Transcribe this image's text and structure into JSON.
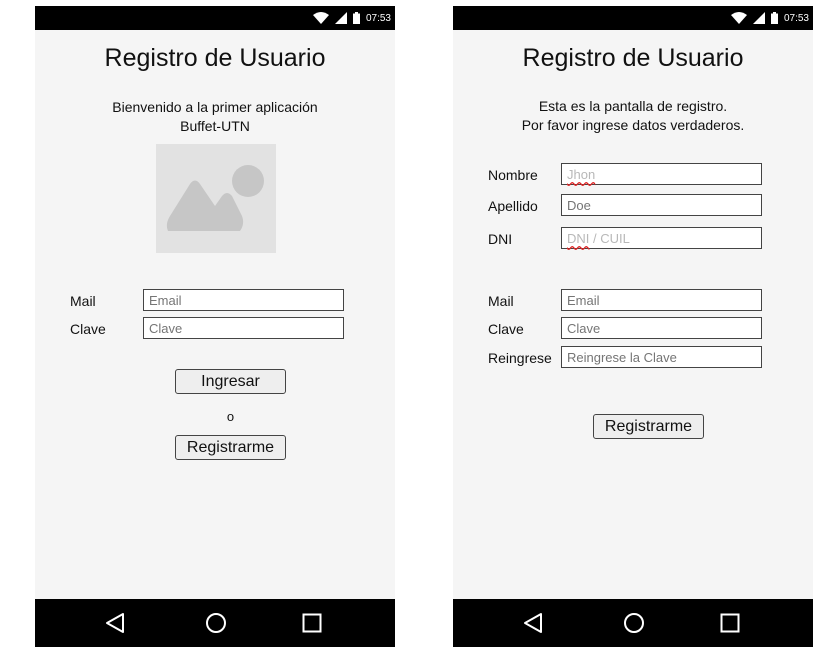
{
  "status": {
    "time": "07:53"
  },
  "login": {
    "title": "Registro de Usuario",
    "welcome_line1": "Bienvenido a la primer aplicación",
    "welcome_line2": "Buffet-UTN",
    "mail_label": "Mail",
    "mail_placeholder": "Email",
    "clave_label": "Clave",
    "clave_placeholder": "Clave",
    "ingresar_label": "Ingresar",
    "or_text": "o",
    "registrarme_label": "Registrarme"
  },
  "register": {
    "title": "Registro de Usuario",
    "intro_line1": "Esta es la pantalla de registro.",
    "intro_line2": "Por favor ingrese datos verdaderos.",
    "nombre_label": "Nombre",
    "nombre_placeholder": "Jhon",
    "apellido_label": "Apellido",
    "apellido_placeholder": "Doe",
    "dni_label": "DNI",
    "dni_placeholder_a": "DNI",
    "dni_placeholder_b": " / CUIL",
    "mail_label": "Mail",
    "mail_placeholder": "Email",
    "clave_label": "Clave",
    "clave_placeholder": "Clave",
    "reingrese_label": "Reingrese",
    "reingrese_placeholder": "Reingrese la Clave",
    "registrarme_label": "Registrarme"
  },
  "icons": {
    "wifi": "wifi-icon",
    "signal": "signal-icon",
    "battery": "battery-icon",
    "back": "back-icon",
    "home": "home-icon",
    "recents": "recents-icon",
    "image": "image-placeholder-icon"
  }
}
